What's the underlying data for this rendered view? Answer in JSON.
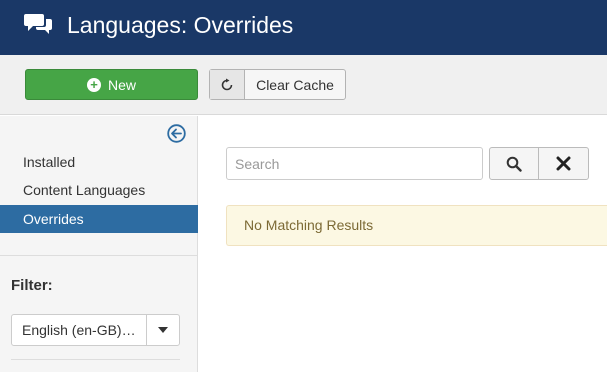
{
  "header": {
    "title": "Languages: Overrides",
    "icon": "comments-icon"
  },
  "toolbar": {
    "new_label": "New",
    "clear_cache_label": "Clear Cache",
    "new_color": "#46a546"
  },
  "sidebar": {
    "items": [
      {
        "label": "Installed",
        "active": false
      },
      {
        "label": "Content Languages",
        "active": false
      },
      {
        "label": "Overrides",
        "active": true
      }
    ],
    "filter_label": "Filter:",
    "language_select": {
      "value": "English (en-GB)…"
    }
  },
  "search": {
    "placeholder": "Search",
    "value": ""
  },
  "main": {
    "message": "No Matching Results"
  },
  "colors": {
    "header_bg": "#1a3867",
    "active_item": "#2d6ca2",
    "alert_bg": "#fcf8e3"
  }
}
